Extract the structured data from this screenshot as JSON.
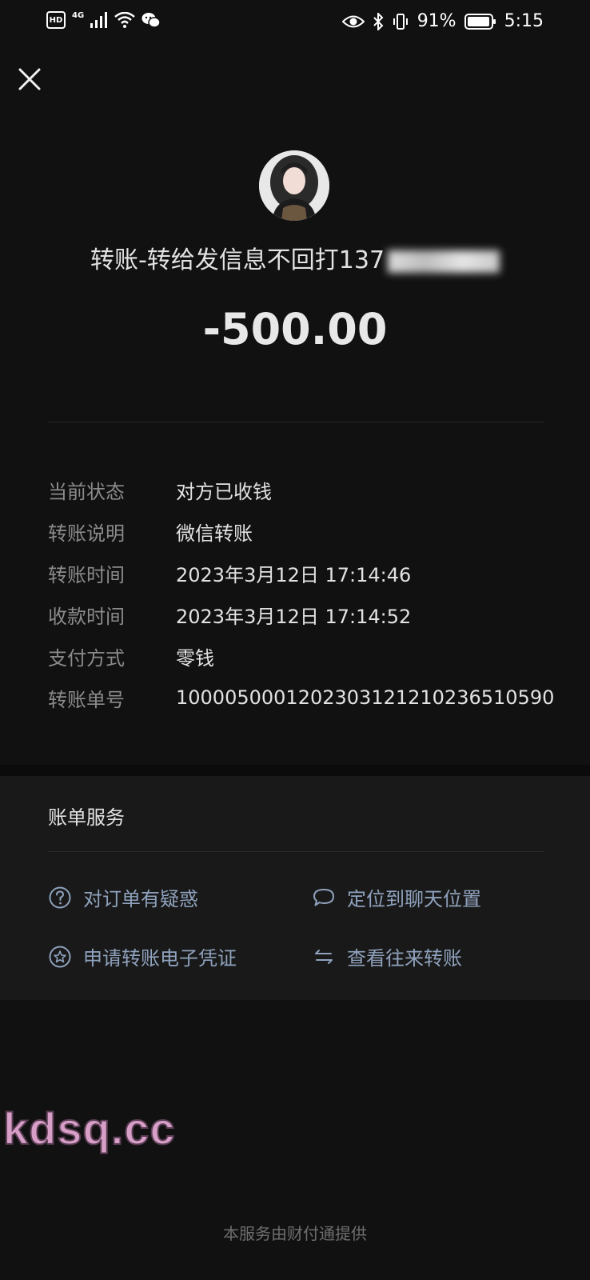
{
  "status_bar": {
    "network": "4G",
    "battery_percent": "91%",
    "time": "5:15"
  },
  "payee_text": "转账-转给发信息不回打137",
  "amount": "-500.00",
  "details": [
    {
      "label": "当前状态",
      "value": "对方已收钱"
    },
    {
      "label": "转账说明",
      "value": "微信转账"
    },
    {
      "label": "转账时间",
      "value": "2023年3月12日 17:14:46"
    },
    {
      "label": "收款时间",
      "value": "2023年3月12日 17:14:52"
    },
    {
      "label": "支付方式",
      "value": "零钱"
    },
    {
      "label": "转账单号",
      "value": "1000050001202303121210236510590"
    }
  ],
  "services": {
    "title": "账单服务",
    "items": [
      {
        "label": "对订单有疑惑",
        "icon": "question-circle-icon"
      },
      {
        "label": "定位到聊天位置",
        "icon": "chat-bubble-icon"
      },
      {
        "label": "申请转账电子凭证",
        "icon": "star-circle-icon"
      },
      {
        "label": "查看往来转账",
        "icon": "swap-arrows-icon"
      }
    ]
  },
  "watermark": "kdsq.cc",
  "footer": "本服务由财付通提供",
  "colors": {
    "background": "#111111",
    "card": "#191919",
    "link": "#8fa2bd",
    "label": "#8b8b8b"
  }
}
